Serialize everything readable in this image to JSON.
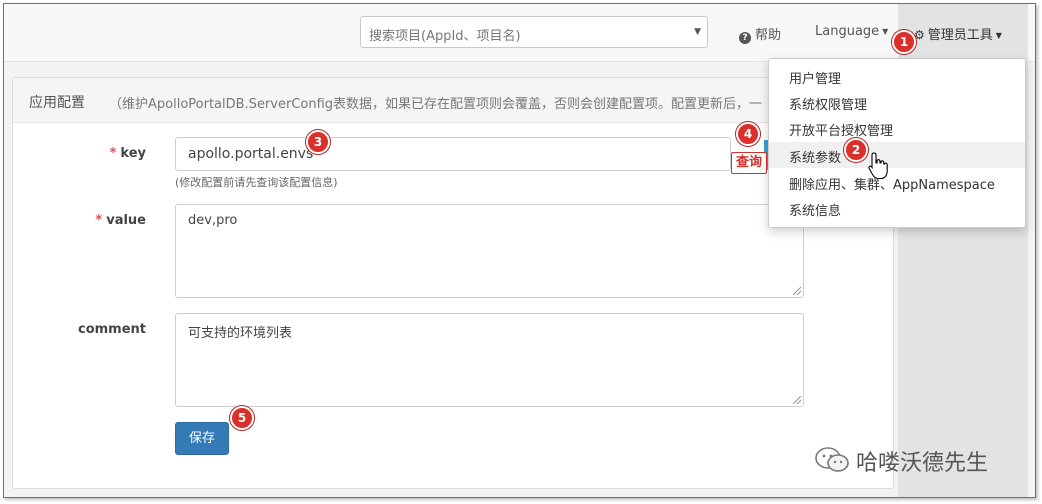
{
  "navbar": {
    "search_placeholder": "搜索项目(AppId、项目名)",
    "help_label": "帮助",
    "language_label": "Language",
    "admin_tools_label": "管理员工具"
  },
  "panel": {
    "title": "应用配置",
    "description": "（维护ApolloPortalDB.ServerConfig表数据，如果已存在配置项则会覆盖，否则会创建配置项。配置更新后，一"
  },
  "form": {
    "key_label": "key",
    "key_value": "apollo.portal.envs",
    "key_hint": "(修改配置前请先查询该配置信息)",
    "query_label": "查询",
    "value_label": "value",
    "value_value": "dev,pro",
    "comment_label": "comment",
    "comment_value": "可支持的环境列表",
    "save_label": "保存",
    "required_mark": "*"
  },
  "dropdown": {
    "items": [
      "用户管理",
      "系统权限管理",
      "开放平台授权管理",
      "系统参数",
      "删除应用、集群、AppNamespace",
      "系统信息"
    ],
    "highlighted_index": 3
  },
  "annotations": {
    "step1": "1",
    "step2": "2",
    "step3": "3",
    "step4": "4",
    "step5": "5"
  },
  "watermark": {
    "text": "哈喽沃德先生"
  },
  "colors": {
    "primary": "#337ab7",
    "badge": "#d9302b",
    "required": "#d9534f"
  }
}
